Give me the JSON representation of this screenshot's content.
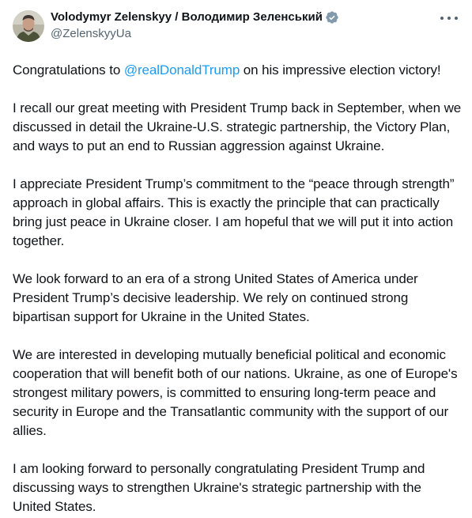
{
  "author": {
    "display_name": "Volodymyr Zelenskyy / Володимир Зеленський",
    "handle": "@ZelenskyyUa",
    "avatar_icon": "avatar-photo",
    "verified_icon": "verified-badge-icon"
  },
  "menu": {
    "icon": "more-options-icon"
  },
  "tweet": {
    "p1_before": "Congratulations to ",
    "p1_mention": "@realDonaldTrump",
    "p1_after": " on his impressive election victory!",
    "p2": "I recall our great meeting with President Trump back in September, when we discussed in detail the Ukraine-U.S. strategic partnership, the Victory Plan, and ways to put an end to Russian aggression against Ukraine.",
    "p3": "I appreciate President Trump’s commitment to the “peace through strength” approach in global affairs. This is exactly the principle that can practically bring just peace in Ukraine closer. I am hopeful that we will put it into action together.",
    "p4": "We look forward to an era of a strong United States of America under President Trump’s decisive leadership. We rely on continued strong bipartisan support for Ukraine in the United States.",
    "p5": "We are interested in developing mutually beneficial political and economic cooperation that will benefit both of our nations. Ukraine, as one of Europe's strongest military powers, is committed to ensuring long-term peace and security in Europe and the Transatlantic community with the support of our allies.",
    "p6": "I am looking forward to personally congratulating President Trump and discussing ways to strengthen Ukraine's strategic partnership with the United States."
  },
  "colors": {
    "link": "#1d9bf0",
    "text": "#0f1419",
    "secondary": "#536471",
    "verified": "#829aab"
  }
}
